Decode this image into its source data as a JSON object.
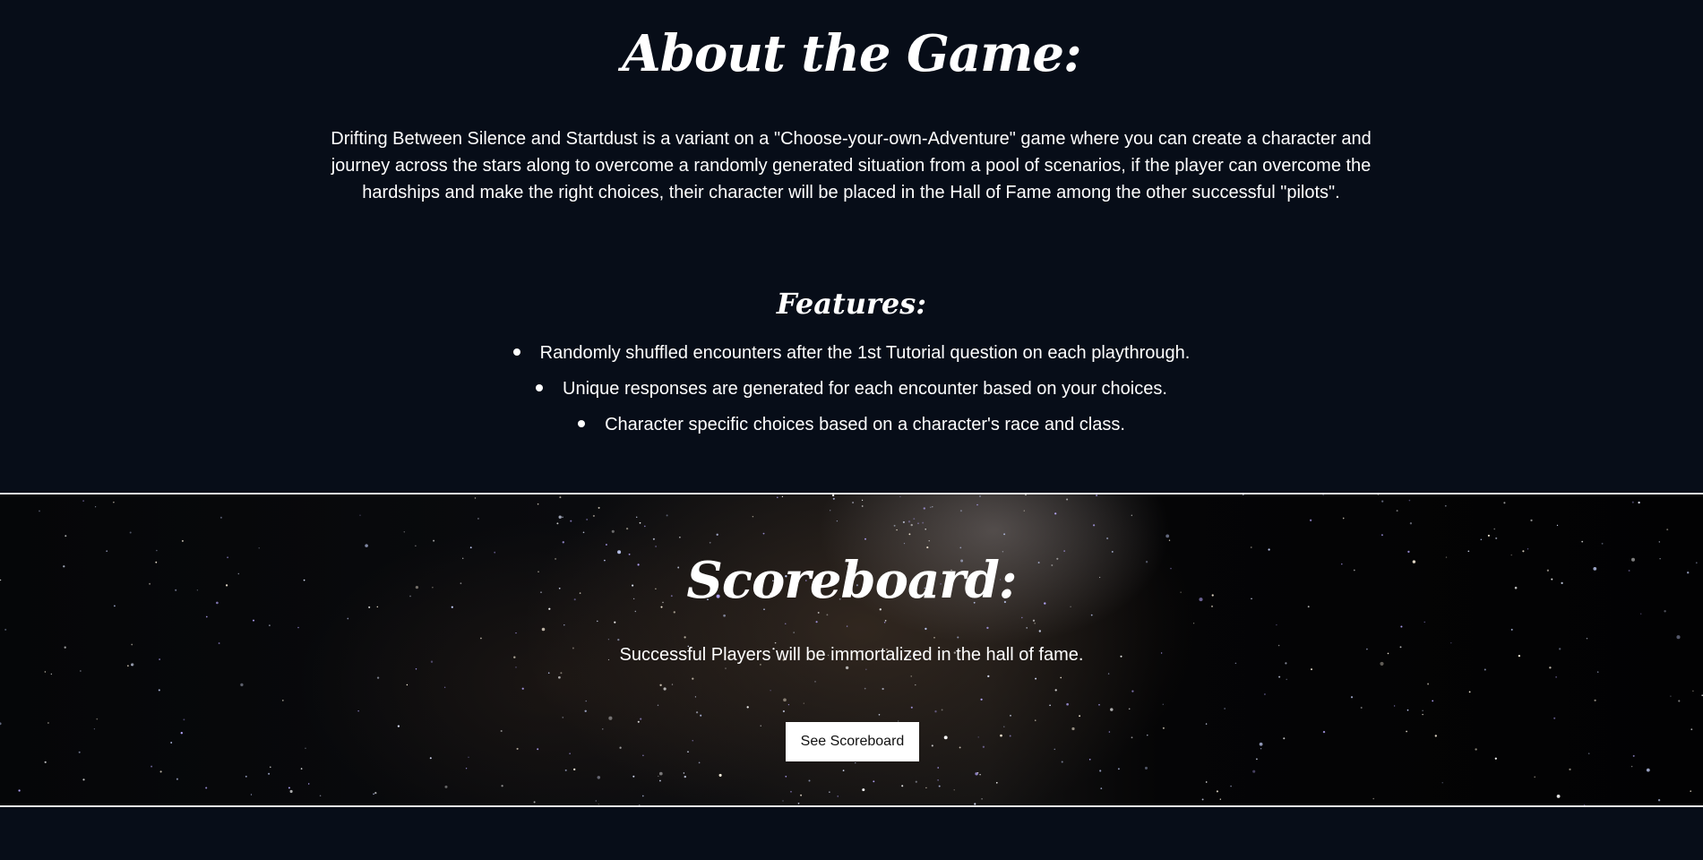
{
  "about": {
    "title": "About the Game:",
    "description": "Drifting Between Silence and Startdust is a variant on a \"Choose-your-own-Adventure\" game where you can create a character and journey across the stars along to overcome a randomly generated situation from a pool of scenarios, if the player can overcome the hardships and make the right choices, their character will be placed in the Hall of Fame among the other successful \"pilots\".",
    "features_title": "Features:",
    "features": [
      "Randomly shuffled encounters after the 1st Tutorial question on each playthrough.",
      "Unique responses are generated for each encounter based on your choices.",
      "Character specific choices based on a character's race and class."
    ]
  },
  "scoreboard": {
    "title": "Scoreboard:",
    "description": "Successful Players will be immortalized in the hall of fame.",
    "button_label": "See Scoreboard"
  },
  "colors": {
    "page_background": "#070d18",
    "text": "#ffffff",
    "divider": "#e8e8e8",
    "button_background": "#ffffff",
    "button_text": "#111111"
  }
}
